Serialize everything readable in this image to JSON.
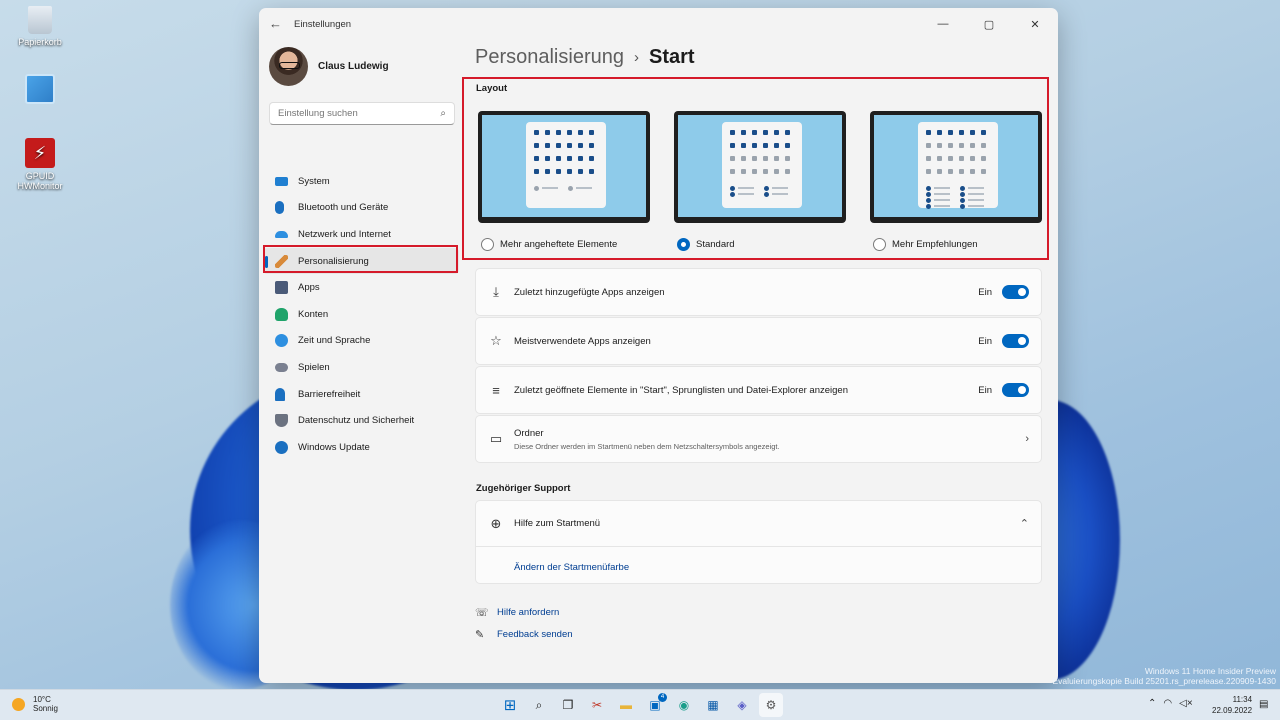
{
  "desktop": {
    "icons": [
      {
        "label": "Papierkorb",
        "icon": "recycle-bin-icon"
      },
      {
        "label": "",
        "icon": "control-panel-icon"
      },
      {
        "label": "GPUID HWMonitor",
        "icon": "hwmonitor-icon"
      }
    ],
    "watermark": {
      "line1": "Windows 11 Home Insider Preview",
      "line2": "Evaluierungskopie Build 25201.rs_prerelease.220909-1430"
    }
  },
  "window": {
    "title": "Einstellungen",
    "controls": {
      "minimize": "—",
      "maximize": "▢",
      "close": "✕"
    }
  },
  "sidebar": {
    "user_name": "Claus Ludewig",
    "search_placeholder": "Einstellung suchen",
    "items": [
      {
        "label": "System",
        "icon": "system-icon",
        "color": "#1f7fd1"
      },
      {
        "label": "Bluetooth und Geräte",
        "icon": "bluetooth-icon",
        "color": "#1a6fc0"
      },
      {
        "label": "Netzwerk und Internet",
        "icon": "network-icon",
        "color": "#2d8fe0"
      },
      {
        "label": "Personalisierung",
        "icon": "brush-icon",
        "color": "#d88a3a",
        "active": true
      },
      {
        "label": "Apps",
        "icon": "apps-icon",
        "color": "#4a5a78"
      },
      {
        "label": "Konten",
        "icon": "accounts-icon",
        "color": "#1fa36a"
      },
      {
        "label": "Zeit und Sprache",
        "icon": "time-language-icon",
        "color": "#2d8fe0"
      },
      {
        "label": "Spielen",
        "icon": "gaming-icon",
        "color": "#7a8090"
      },
      {
        "label": "Barrierefreiheit",
        "icon": "accessibility-icon",
        "color": "#1a6fc0"
      },
      {
        "label": "Datenschutz und Sicherheit",
        "icon": "shield-icon",
        "color": "#6b7280"
      },
      {
        "label": "Windows Update",
        "icon": "update-icon",
        "color": "#1a6fc0"
      }
    ]
  },
  "content": {
    "breadcrumb_parent": "Personalisierung",
    "breadcrumb_sep": "›",
    "breadcrumb_current": "Start",
    "layout": {
      "title": "Layout",
      "options": [
        {
          "label": "Mehr angeheftete Elemente",
          "selected": false
        },
        {
          "label": "Standard",
          "selected": true
        },
        {
          "label": "Mehr Empfehlungen",
          "selected": false
        }
      ]
    },
    "settings": [
      {
        "label": "Zuletzt hinzugefügte Apps anzeigen",
        "state": "Ein",
        "icon": "download-icon"
      },
      {
        "label": "Meistverwendete Apps anzeigen",
        "state": "Ein",
        "icon": "star-icon"
      },
      {
        "label": "Zuletzt geöffnete Elemente in \"Start\", Sprunglisten und Datei-Explorer anzeigen",
        "state": "Ein",
        "icon": "list-icon"
      }
    ],
    "folders": {
      "title": "Ordner",
      "subtitle": "Diese Ordner werden im Startmenü neben dem Netzschaltersymbols angezeigt."
    },
    "support": {
      "title": "Zugehöriger Support",
      "help_title": "Hilfe zum Startmenü",
      "link": "Ändern der Startmenüfarbe"
    },
    "footer": {
      "help": "Hilfe anfordern",
      "feedback": "Feedback senden"
    }
  },
  "taskbar": {
    "weather_temp": "10°C",
    "weather_desc": "Sonnig",
    "teams_badge": "4",
    "time": "11:34",
    "date": "22.09.2022"
  }
}
